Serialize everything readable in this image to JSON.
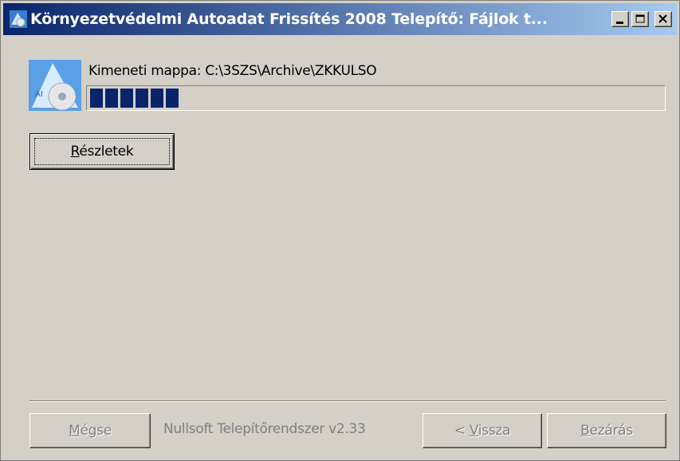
{
  "window": {
    "title": "Környezetvédelmi Autoadat Frissítés 2008 Telepítő: Fájlok t..."
  },
  "content": {
    "output_label": "Kimeneti mappa: C:\\3SZS\\Archive\\ZKKULSO",
    "progress_percent": 17,
    "details_button": {
      "accel": "R",
      "rest": "észletek"
    }
  },
  "footer": {
    "branding": "Nullsoft Telepítőrendszer v2.33",
    "cancel_button": {
      "accel": "M",
      "rest": "égse"
    },
    "back_button": {
      "prefix": "< ",
      "accel": "V",
      "rest": "issza"
    },
    "close_button": {
      "accel": "B",
      "rest": "ezárás"
    }
  },
  "colors": {
    "titlebar_start": "#0a246a",
    "titlebar_end": "#a6caf0",
    "progress": "#0a246a",
    "face": "#d4d0c8"
  },
  "icons": [
    "installer-app-icon",
    "minimize-icon",
    "maximize-icon",
    "close-icon"
  ]
}
